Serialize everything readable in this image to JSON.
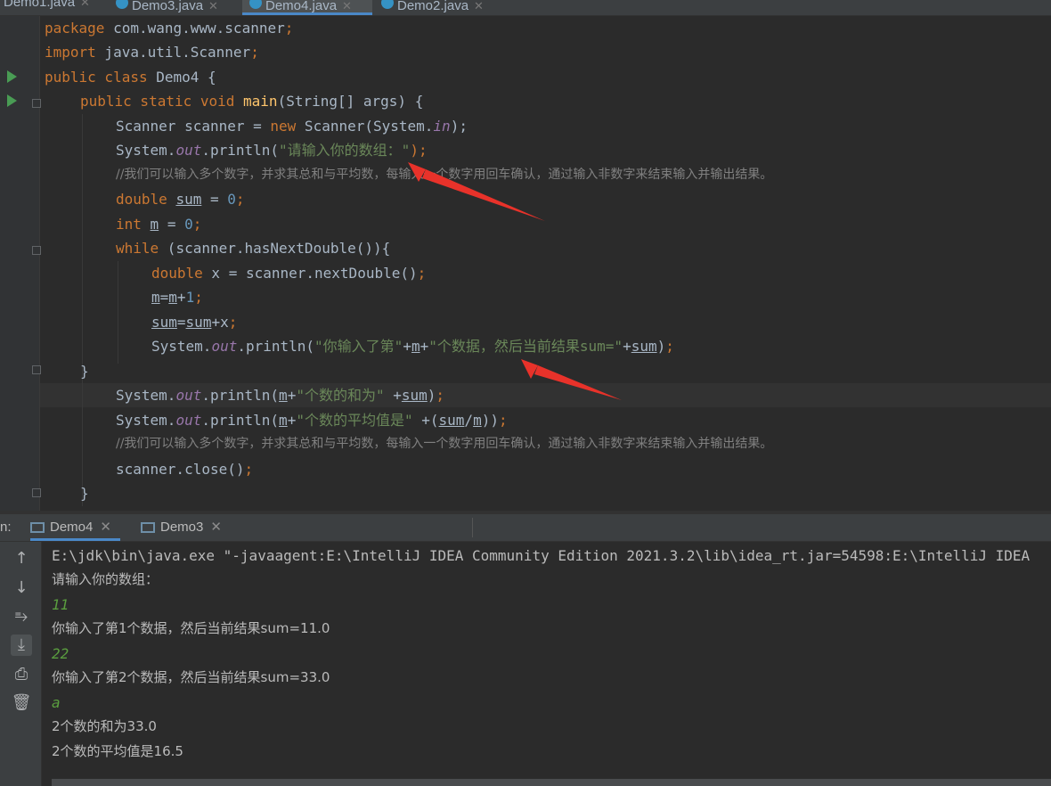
{
  "editor_tabs": [
    {
      "label": "Demo1.java",
      "active": false
    },
    {
      "label": "Demo3.java",
      "active": false
    },
    {
      "label": "Demo4.java",
      "active": true
    },
    {
      "label": "Demo2.java",
      "active": false
    }
  ],
  "code": {
    "l1_a": "package",
    "l1_b": " com.wang.www.scanner",
    "l1_c": ";",
    "l2_a": "import",
    "l2_b": " java.util.Scanner",
    "l2_c": ";",
    "l3_a": "public class",
    "l3_b": " Demo4 {",
    "l4_a": "public static void",
    "l4_b": "main",
    "l4_c": "(String[] args) {",
    "l5_a": "Scanner scanner = ",
    "l5_b": "new",
    "l5_c": " Scanner(System.",
    "l5_d": "in",
    "l5_e": ");",
    "l6_a": "System.",
    "l6_b": "out",
    "l6_c": ".println(",
    "l6_d": "\"请输入你的数组：\"",
    "l6_e": ");",
    "l7": "//我们可以输入多个数字，并求其总和与平均数，每输入一个数字用回车确认，通过输入非数字来结束输入并输出结果。",
    "l8_a": "double",
    "l8_b": "sum",
    "l8_c": " = ",
    "l8_d": "0",
    "l8_e": ";",
    "l9_a": "int",
    "l9_b": "m",
    "l9_c": " = ",
    "l9_d": "0",
    "l9_e": ";",
    "l10_a": "while",
    "l10_b": " (scanner.hasNextDouble()){",
    "l11_a": "double",
    "l11_b": " x = scanner.nextDouble()",
    "l11_c": ";",
    "l12_a": "m",
    "l12_b": "=",
    "l12_c": "m",
    "l12_d": "+",
    "l12_e": "1",
    "l12_f": ";",
    "l13_a": "sum",
    "l13_b": "=",
    "l13_c": "sum",
    "l13_d": "+x",
    "l13_e": ";",
    "l14_a": "System.",
    "l14_b": "out",
    "l14_c": ".println(",
    "l14_d": "\"你输入了第\"",
    "l14_e": "+",
    "l14_f": "m",
    "l14_g": "+",
    "l14_h": "\"个数据，然后当前结果sum=\"",
    "l14_i": "+",
    "l14_j": "sum",
    "l14_k": ")",
    "l14_l": ";",
    "l15": "}",
    "l16_a": "System.",
    "l16_b": "out",
    "l16_c": ".println(",
    "l16_d": "m",
    "l16_e": "+",
    "l16_f": "\"个数的和为\"",
    "l16_g": " +",
    "l16_h": "sum",
    "l16_i": ")",
    "l16_j": ";",
    "l17_a": "System.",
    "l17_b": "out",
    "l17_c": ".println(",
    "l17_d": "m",
    "l17_e": "+",
    "l17_f": "\"个数的平均值是\"",
    "l17_g": " +(",
    "l17_h": "sum",
    "l17_i": "/",
    "l17_j": "m",
    "l17_k": "))",
    "l17_l": ";",
    "l18": "//我们可以输入多个数字，并求其总和与平均数，每输入一个数字用回车确认，通过输入非数字来结束输入并输出结果。",
    "l19_a": "scanner.close()",
    "l19_b": ";",
    "l20": "}"
  },
  "run_panel": {
    "prefix": "n:",
    "tabs": [
      {
        "label": "Demo4",
        "active": true
      },
      {
        "label": "Demo3",
        "active": false
      }
    ]
  },
  "console": [
    {
      "text": "E:\\jdk\\bin\\java.exe \"-javaagent:E:\\IntelliJ IDEA Community Edition 2021.3.2\\lib\\idea_rt.jar=54598:E:\\IntelliJ IDEA",
      "kind": "output"
    },
    {
      "text": "请输入你的数组：",
      "kind": "output"
    },
    {
      "text": "11",
      "kind": "input"
    },
    {
      "text": "你输入了第1个数据，然后当前结果sum=11.0",
      "kind": "output"
    },
    {
      "text": "22",
      "kind": "input"
    },
    {
      "text": "你输入了第2个数据，然后当前结果sum=33.0",
      "kind": "output"
    },
    {
      "text": "a",
      "kind": "input"
    },
    {
      "text": "2个数的和为33.0",
      "kind": "output"
    },
    {
      "text": "2个数的平均值是16.5",
      "kind": "output"
    }
  ],
  "colors": {
    "keyword": "#cc7832",
    "string": "#6a8759",
    "field": "#9876aa",
    "number": "#6897bb",
    "method": "#ffc66d",
    "comment": "#808080",
    "annotation_arrow": "#e8322a"
  },
  "icons": {
    "run_toolbar": [
      "arrow-up-icon",
      "arrow-down-icon",
      "soft-wrap-icon",
      "scroll-to-end-icon",
      "print-icon",
      "trash-icon"
    ]
  }
}
